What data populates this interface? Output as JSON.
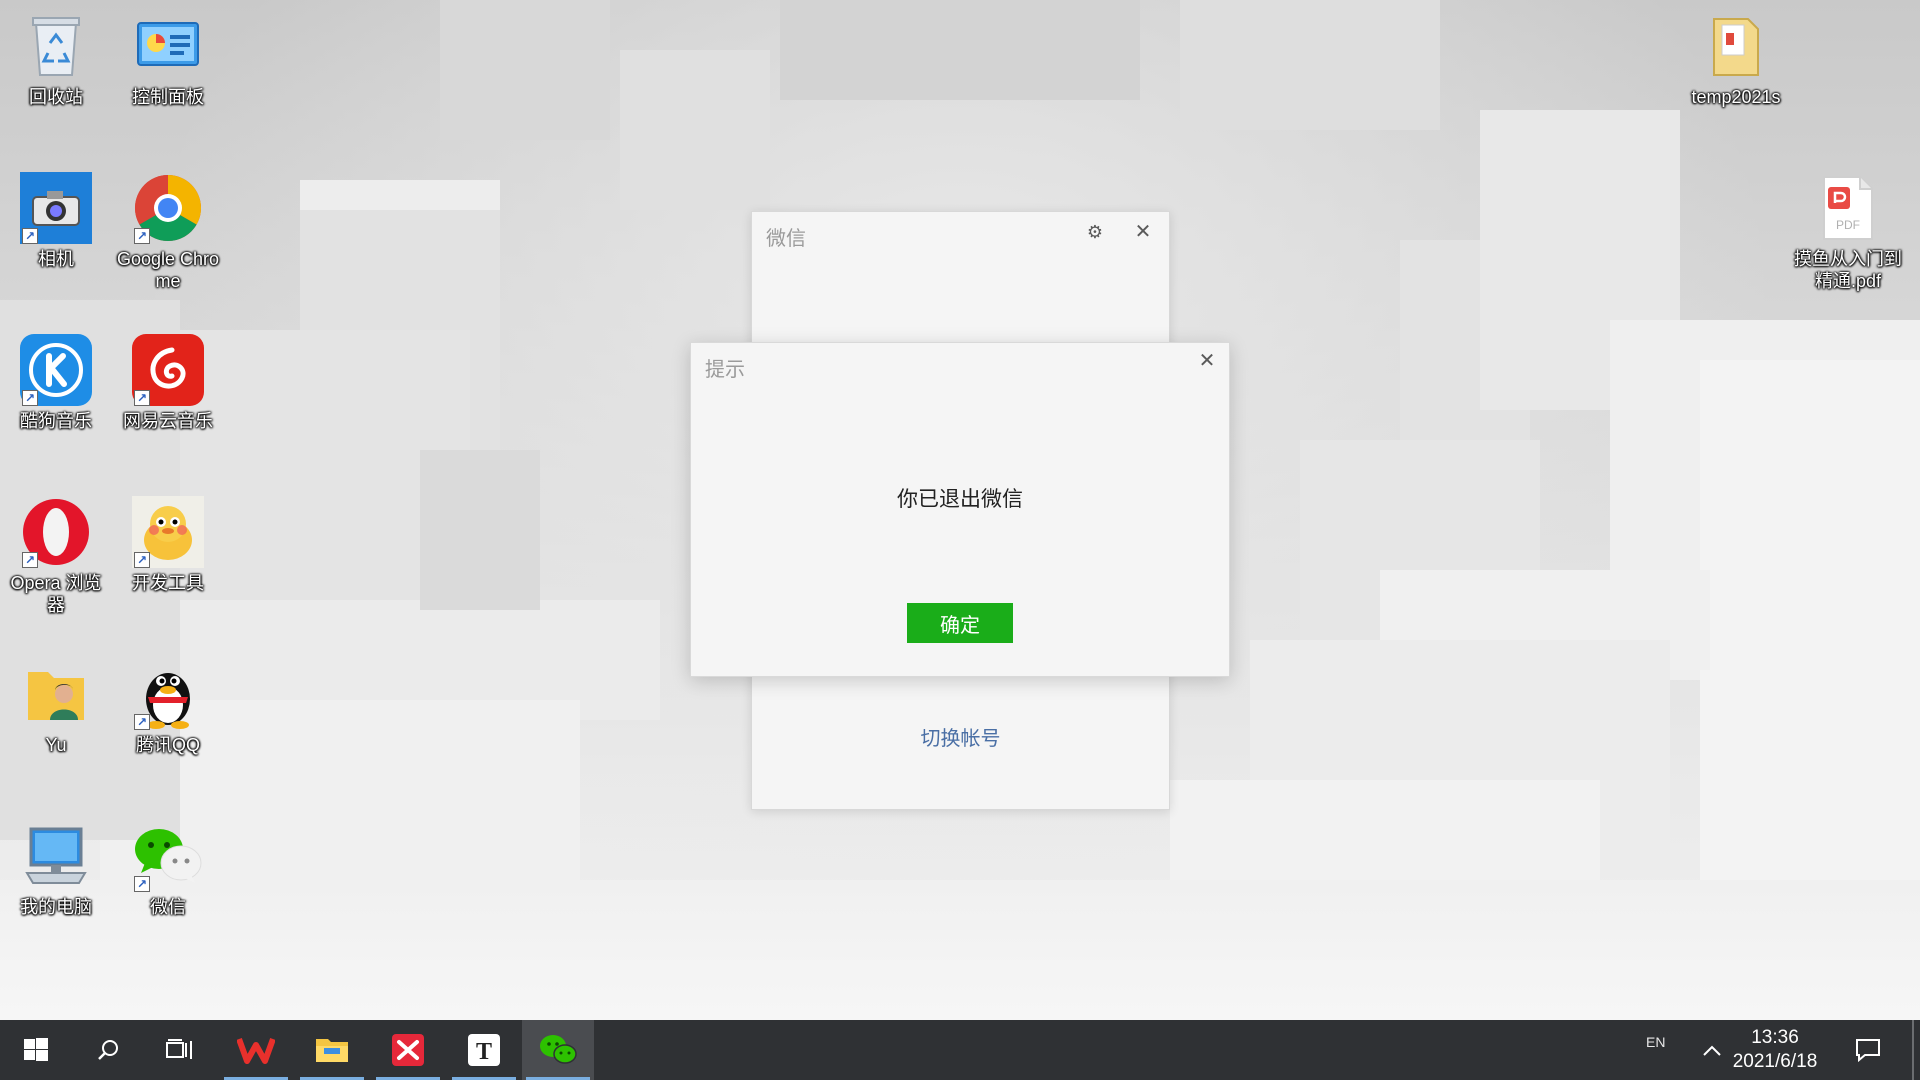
{
  "desktop": {
    "icons": [
      {
        "id": "recycle-bin",
        "label": "回收站",
        "icon": "recycle-bin-icon"
      },
      {
        "id": "control-panel",
        "label": "控制面板",
        "icon": "control-panel-icon"
      },
      {
        "id": "camera",
        "label": "相机",
        "icon": "camera-icon"
      },
      {
        "id": "chrome",
        "label": "Google Chrome",
        "icon": "chrome-icon"
      },
      {
        "id": "kugou",
        "label": "酷狗音乐",
        "icon": "kugou-icon"
      },
      {
        "id": "netease",
        "label": "网易云音乐",
        "icon": "netease-music-icon"
      },
      {
        "id": "opera",
        "label": "Opera 浏览器",
        "icon": "opera-icon"
      },
      {
        "id": "devtools",
        "label": "开发工具",
        "icon": "devtools-icon"
      },
      {
        "id": "yu",
        "label": "Yu",
        "icon": "user-folder-icon"
      },
      {
        "id": "qq",
        "label": "腾讯QQ",
        "icon": "qq-penguin-icon"
      },
      {
        "id": "my-computer",
        "label": "我的电脑",
        "icon": "computer-icon"
      },
      {
        "id": "wechat",
        "label": "微信",
        "icon": "wechat-icon"
      },
      {
        "id": "temp",
        "label": "temp2021s",
        "icon": "folder-icon"
      },
      {
        "id": "pdf",
        "label": "摸鱼从入门到精通.pdf",
        "icon": "pdf-file-icon"
      }
    ]
  },
  "wechat_window": {
    "title": "微信",
    "switch_account": "切换帐号"
  },
  "tip_dialog": {
    "title": "提示",
    "message": "你已退出微信",
    "ok_label": "确定"
  },
  "taskbar": {
    "lang": "EN",
    "time": "13:36",
    "date": "2021/6/18"
  },
  "colors": {
    "wechat_green": "#1aad19",
    "link_blue": "#4a6fa5",
    "taskbar_bg": "#2f3134"
  }
}
